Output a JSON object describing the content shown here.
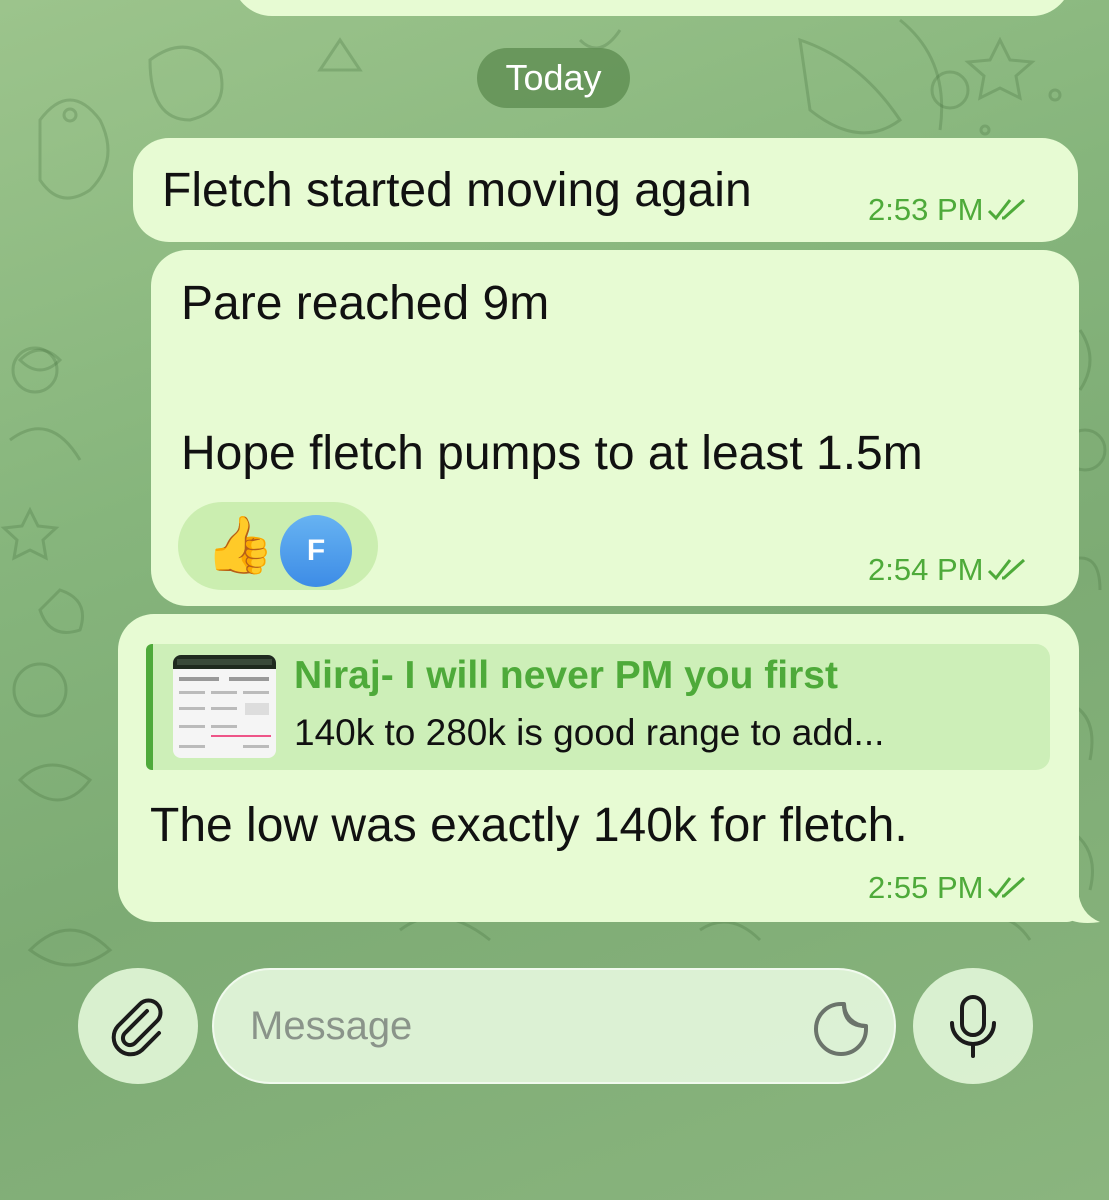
{
  "date_separator": "Today",
  "messages": [
    {
      "text": "Fletch started moving again",
      "time": "2:53 PM",
      "status": "read"
    },
    {
      "line1": "Pare reached 9m",
      "line2": "Hope fletch pumps to at least 1.5m",
      "time": "2:54 PM",
      "status": "read",
      "reaction": {
        "emoji": "👍",
        "avatar_letter": "F"
      }
    },
    {
      "reply_to": {
        "sender": "Niraj- I will never PM you first",
        "snippet": "140k to 280k is good range to add..."
      },
      "text": "The low was exactly 140k for fletch.",
      "time": "2:55 PM",
      "status": "read"
    }
  ],
  "composer": {
    "placeholder": "Message",
    "attach_icon": "paperclip-icon",
    "sticker_icon": "sticker-icon",
    "mic_icon": "microphone-icon"
  },
  "colors": {
    "bubble": "#e7fbd3",
    "accent": "#4eaa3a",
    "date_pill": "#629155",
    "background": "#8ab57e"
  }
}
